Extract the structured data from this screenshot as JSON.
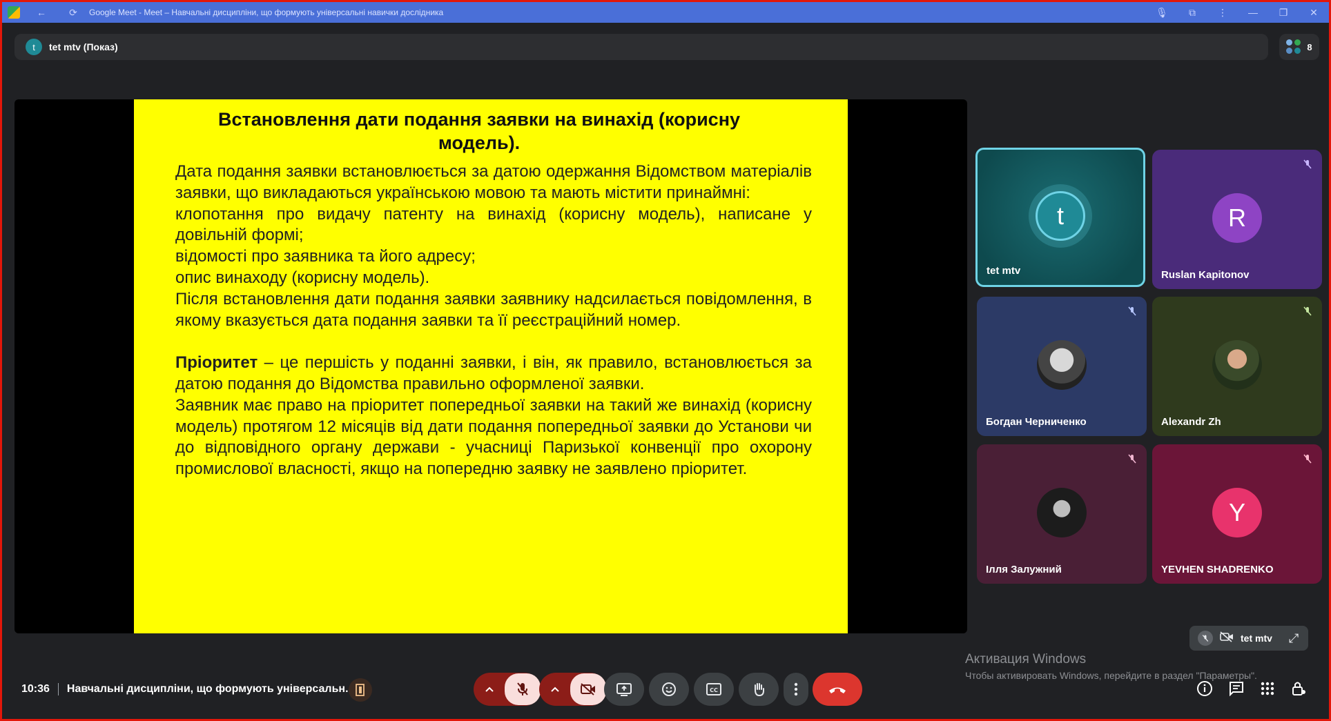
{
  "window": {
    "title": "Google Meet - Meet – Навчальні дисципліни, що формують універсальні навички дослідника"
  },
  "presenter": {
    "initial": "t",
    "label": "tet mtv (Показ)"
  },
  "people_count": "8",
  "slide": {
    "title": "Встановлення дати подання заявки на винахід (корисну модель).",
    "paragraphs": [
      "Дата подання заявки встановлюється за датою одержання Відомством матеріалів заявки, що викладаються українською мовою та мають містити принаймні:",
      "клопотання про видачу патенту на винахід (корисну модель), написане у довільній формі;",
      "відомості про заявника та його адресу;",
      "опис винаходу (корисну модель).",
      "Після встановлення дати подання заявки заявнику надсилається повідомлення, в якому вказується дата подання заявки та її реєстраційний номер."
    ],
    "priority_term": "Пріоритет",
    "priority_rest": " – це першість у поданні заявки, і він, як правило, встановлюється за датою подання до Відомства правильно оформленої заявки.",
    "paragraph_last": "Заявник має право на пріоритет попередньої заявки на такий же винахід (корисну модель) протягом 12 місяців від дати подання попередньої заявки до Установи чи до відповідного органу держави - учасниці Паризької конвенції про охорону промислової власності, якщо на попередню заявку не заявлено пріоритет."
  },
  "participants": [
    {
      "name": "tet mtv",
      "initial": "t",
      "avatar_color": "#1f8a96",
      "tile_color": "#0f5458",
      "muted": false
    },
    {
      "name": "Ruslan Kapitonov",
      "initial": "R",
      "avatar_color": "#8e44c4",
      "tile_color": "#4a2b7a",
      "muted": true
    },
    {
      "name": "Богдан Черниченко",
      "initial": "",
      "avatar_color": "#777777",
      "tile_color": "#2c3a66",
      "muted": true
    },
    {
      "name": "Alexandr Zh",
      "initial": "",
      "avatar_color": "#5a6e3a",
      "tile_color": "#2f3a1d",
      "muted": true
    },
    {
      "name": "Ілля Залужний",
      "initial": "",
      "avatar_color": "#333333",
      "tile_color": "#4a1f36",
      "muted": true
    },
    {
      "name": "YEVHEN SHADRENKO",
      "initial": "Y",
      "avatar_color": "#e8336c",
      "tile_color": "#6b1538",
      "muted": true
    }
  ],
  "self_view": {
    "name": "tet mtv"
  },
  "watermark": {
    "line1": "Активация Windows",
    "line2": "Чтобы активировать Windows, перейдите в раздел \"Параметры\"."
  },
  "bottom": {
    "time": "10:36",
    "meeting_title": "Навчальні дисципліни, що формують універсальн..."
  },
  "colors": {
    "accent_red": "#8c1d18",
    "end_call": "#dc362e",
    "slide_bg": "#ffff00"
  }
}
